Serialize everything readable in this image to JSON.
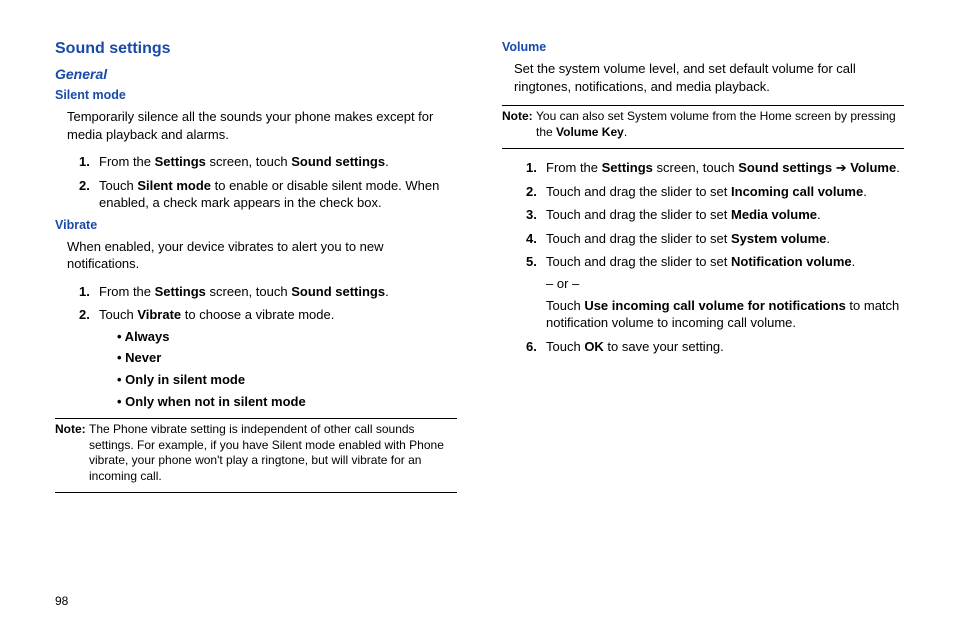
{
  "left": {
    "title": "Sound settings",
    "sub1": "General",
    "silent": {
      "heading": "Silent mode",
      "desc": "Temporarily silence all the sounds your phone makes except for media playback and alarms.",
      "steps": [
        {
          "pre": "From the ",
          "b1": "Settings",
          "mid": " screen, touch ",
          "b2": "Sound settings",
          "post": "."
        },
        {
          "pre": "Touch ",
          "b1": "Silent mode",
          "mid": " to enable or disable silent mode. When enabled, a check mark appears in the check box.",
          "b2": "",
          "post": ""
        }
      ]
    },
    "vibrate": {
      "heading": "Vibrate",
      "desc": "When enabled, your device vibrates to alert you to new notifications.",
      "step1_pre": "From the ",
      "step1_b1": "Settings",
      "step1_mid": " screen, touch ",
      "step1_b2": "Sound settings",
      "step1_post": ".",
      "step2_pre": "Touch ",
      "step2_b1": "Vibrate",
      "step2_post": " to choose a vibrate mode.",
      "options": [
        "• Always",
        "• Never",
        "• Only in silent mode",
        "• Only when not in silent mode"
      ]
    },
    "note": {
      "label": "Note:",
      "text": " The Phone vibrate setting is independent of other call sounds settings. For example, if you have Silent mode enabled with Phone vibrate, your phone won't play a ringtone, but will vibrate for an incoming call."
    }
  },
  "right": {
    "volume": {
      "heading": "Volume",
      "desc": "Set the system volume level, and set default volume for call ringtones, notifications, and media playback.",
      "note_label": "Note:",
      "note_text_pre": " You can also set System volume from the Home screen by pressing the ",
      "note_text_b": "Volume Key",
      "note_text_post": ".",
      "s1_pre": "From the ",
      "s1_b1": "Settings",
      "s1_mid": " screen, touch ",
      "s1_b2": "Sound settings",
      "s1_arrow": " ➔ ",
      "s1_b3": "Volume",
      "s1_post": ".",
      "s2_pre": "Touch and drag the slider to set ",
      "s2_b": "Incoming call volume",
      "s2_post": ".",
      "s3_pre": "Touch and drag the slider to set ",
      "s3_b": "Media volume",
      "s3_post": ".",
      "s4_pre": "Touch and drag the slider to set ",
      "s4_b": "System volume",
      "s4_post": ".",
      "s5_pre": "Touch and drag the slider to set ",
      "s5_b": "Notification volume",
      "s5_post": ".",
      "or": "– or –",
      "s5b_pre": "Touch ",
      "s5b_b": "Use incoming call volume for notifications",
      "s5b_post": " to match notification volume to incoming call volume.",
      "s6_pre": "Touch ",
      "s6_b": "OK",
      "s6_post": " to save your setting."
    }
  },
  "page": "98"
}
